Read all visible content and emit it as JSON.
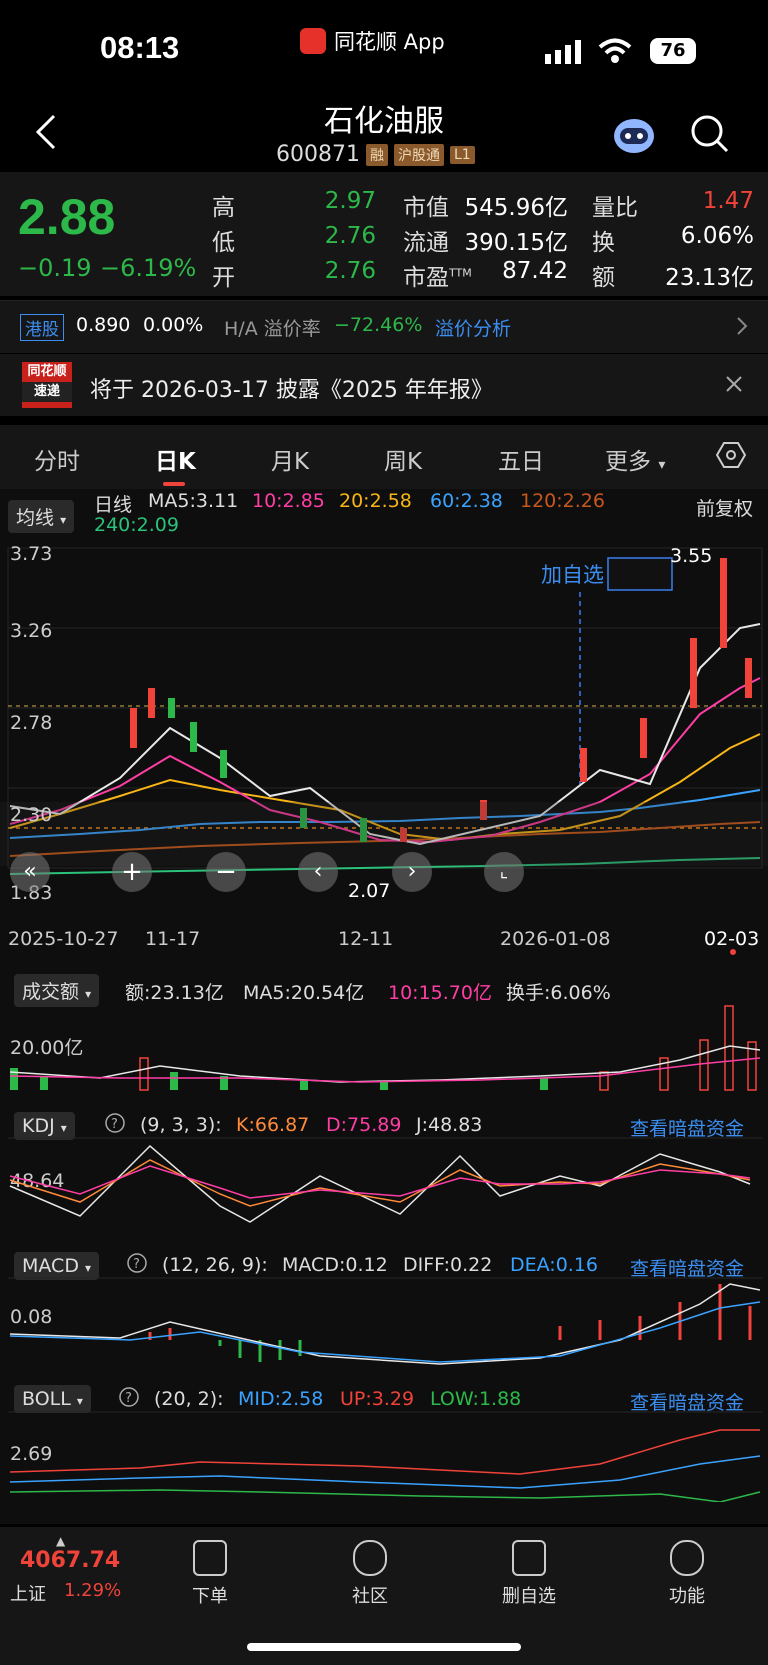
{
  "status": {
    "time": "08:13",
    "app": "同花顺 App",
    "battery": "76"
  },
  "header": {
    "name": "石化油服",
    "code": "600871",
    "tags": [
      "融",
      "沪股通",
      "L1"
    ]
  },
  "quote": {
    "price": "2.88",
    "change": "−0.19",
    "change_pct": "−6.19%",
    "high_label": "高",
    "high": "2.97",
    "low_label": "低",
    "low": "2.76",
    "open_label": "开",
    "open": "2.76",
    "mktcap_label": "市值",
    "mktcap": "545.96亿",
    "float_label": "流通",
    "float": "390.15亿",
    "pe_label": "市盈",
    "pe_sup": "TTM",
    "pe": "87.42",
    "vr_label": "量比",
    "vr": "1.47",
    "turn_label": "换",
    "turn": "6.06%",
    "amt_label": "额",
    "amt": "23.13亿"
  },
  "hk": {
    "tag": "港股",
    "price": "0.890",
    "pct": "0.00%",
    "premium_label": "H/A 溢价率",
    "premium": "−72.46%",
    "link": "溢价分析"
  },
  "news": {
    "logo_top": "同花顺",
    "logo_bottom": "速递",
    "text": "将于 2026-03-17 披露《2025 年年报》"
  },
  "tabs": [
    "分时",
    "日K",
    "月K",
    "周K",
    "五日",
    "更多"
  ],
  "ma": {
    "selector": "均线",
    "type": "日线",
    "ma5": "MA5:3.11",
    "ma10": "10:2.85",
    "ma20": "20:2.58",
    "ma60": "60:2.38",
    "ma120": "120:2.26",
    "ma240": "240:2.09",
    "adjust": "前复权"
  },
  "kline": {
    "y_ticks": [
      "3.73",
      "3.26",
      "2.78",
      "2.30",
      "1.83"
    ],
    "high_mark": "3.55",
    "low_mark": "2.07",
    "add_fav": "加自选",
    "x_ticks": [
      "2025-10-27",
      "11-17",
      "12-11",
      "2026-01-08",
      "02-03"
    ]
  },
  "volume": {
    "selector": "成交额",
    "amount": "额:23.13亿",
    "ma5": "MA5:20.54亿",
    "ma10": "10:15.70亿",
    "turn": "换手:6.06%",
    "y_tick": "20.00亿"
  },
  "kdj": {
    "selector": "KDJ",
    "params": "(9, 3, 3):",
    "k": "K:66.87",
    "d": "D:75.89",
    "j": "J:48.83",
    "link": "查看暗盘资金",
    "y_tick": "48.64"
  },
  "macd": {
    "selector": "MACD",
    "params": "(12, 26, 9):",
    "macd": "MACD:0.12",
    "diff": "DIFF:0.22",
    "dea": "DEA:0.16",
    "link": "查看暗盘资金",
    "y_tick": "0.08"
  },
  "boll": {
    "selector": "BOLL",
    "params": "(20, 2):",
    "mid": "MID:2.58",
    "up": "UP:3.29",
    "low": "LOW:1.88",
    "link": "查看暗盘资金",
    "y_tick": "2.69"
  },
  "bottom": {
    "index_value": "4067.74",
    "index_name": "上证",
    "index_pct": "1.29%",
    "nav": [
      "下单",
      "社区",
      "删自选",
      "功能"
    ]
  }
}
